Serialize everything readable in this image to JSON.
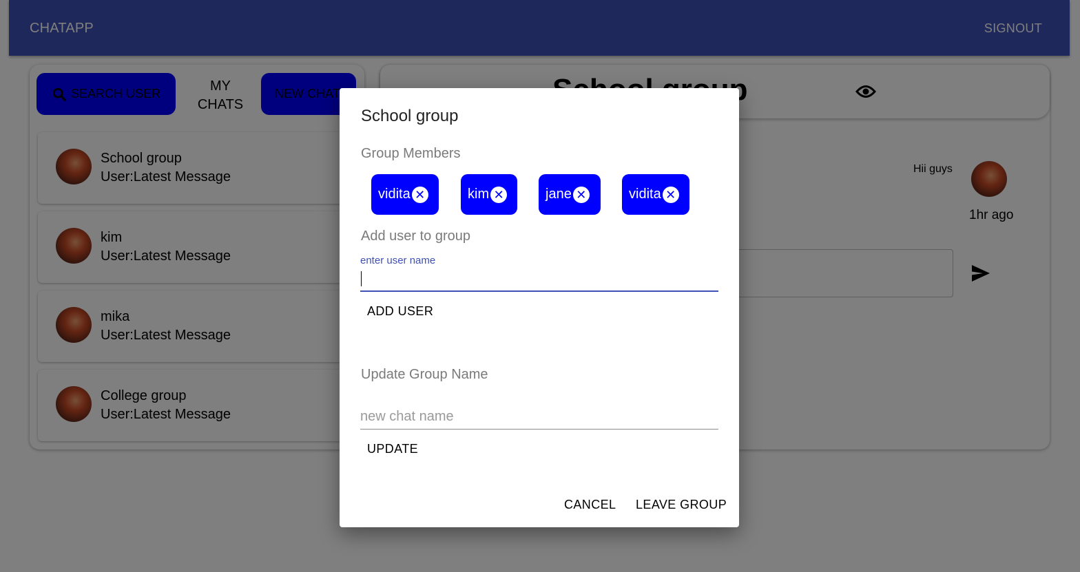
{
  "app": {
    "brand": "CHATAPP",
    "signout": "SIGNOUT",
    "accent": "#3f51b5",
    "button_color": "#0000ff"
  },
  "sidebar": {
    "search_button": "SEARCH USER",
    "my_chats": "MY CHATS",
    "new_chat_button": "NEW CHAT",
    "chats": [
      {
        "name": "School group",
        "latest": "User:Latest Message"
      },
      {
        "name": "kim",
        "latest": "User:Latest Message"
      },
      {
        "name": "mika",
        "latest": "User:Latest Message"
      },
      {
        "name": "College group",
        "latest": "User:Latest Message"
      }
    ]
  },
  "chat": {
    "title": "School group",
    "messages": [
      {
        "text": "Hii guys",
        "time": "1hr ago"
      }
    ]
  },
  "dialog": {
    "title": "School group",
    "members_label": "Group Members",
    "members": [
      "vidita",
      "kim",
      "jane",
      "vidita"
    ],
    "add_label": "Add user to group",
    "add_input_label": "enter user name",
    "add_button": "ADD USER",
    "update_label": "Update Group Name",
    "update_placeholder": "new chat name",
    "update_button": "UPDATE",
    "cancel_button": "CANCEL",
    "leave_button": "LEAVE GROUP"
  }
}
